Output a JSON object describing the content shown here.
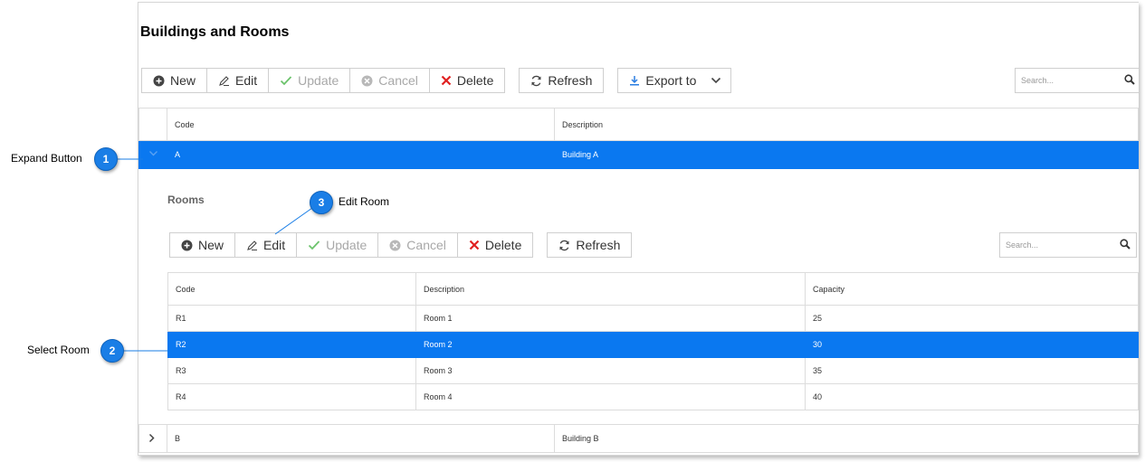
{
  "title": "Buildings and Rooms",
  "toolbar": {
    "new": "New",
    "edit": "Edit",
    "update": "Update",
    "cancel": "Cancel",
    "delete": "Delete",
    "refresh": "Refresh",
    "export": "Export to"
  },
  "search": {
    "placeholder": "Search..."
  },
  "buildings": {
    "headers": {
      "code": "Code",
      "description": "Description"
    },
    "rows": [
      {
        "code": "A",
        "description": "Building A"
      },
      {
        "code": "B",
        "description": "Building B"
      }
    ]
  },
  "rooms": {
    "title": "Rooms",
    "toolbar": {
      "new": "New",
      "edit": "Edit",
      "update": "Update",
      "cancel": "Cancel",
      "delete": "Delete",
      "refresh": "Refresh"
    },
    "search_placeholder": "Search...",
    "headers": {
      "code": "Code",
      "description": "Description",
      "capacity": "Capacity"
    },
    "rows": [
      {
        "code": "R1",
        "description": "Room 1",
        "capacity": "25"
      },
      {
        "code": "R2",
        "description": "Room 2",
        "capacity": "30"
      },
      {
        "code": "R3",
        "description": "Room 3",
        "capacity": "35"
      },
      {
        "code": "R4",
        "description": "Room 4",
        "capacity": "40"
      }
    ]
  },
  "callouts": [
    {
      "number": "1",
      "label": "Expand Button"
    },
    {
      "number": "2",
      "label": "Select Room"
    },
    {
      "number": "3",
      "label": "Edit Room"
    }
  ],
  "colors": {
    "selection": "#0a78f0",
    "callout": "#1a7ee6",
    "delete": "#e02020",
    "check": "#6cc36c"
  }
}
